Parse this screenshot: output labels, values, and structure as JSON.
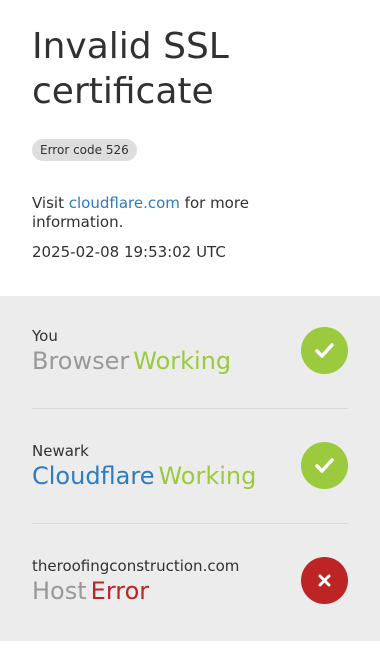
{
  "header": {
    "title": "Invalid SSL certificate",
    "error_code": "Error code 526",
    "visit_prefix": "Visit",
    "visit_link": "cloudflare.com",
    "visit_suffix": "for more information.",
    "timestamp": "2025-02-08 19:53:02 UTC"
  },
  "status": {
    "rows": [
      {
        "location": "You",
        "name": "Browser",
        "status": "Working",
        "state": "ok",
        "icon": "checkmark-icon"
      },
      {
        "location": "Newark",
        "name": "Cloudflare",
        "status": "Working",
        "state": "ok",
        "icon": "checkmark-icon"
      },
      {
        "location": "theroofingconstruction.com",
        "name": "Host",
        "status": "Error",
        "state": "error",
        "icon": "x-icon"
      }
    ]
  },
  "colors": {
    "ok": "#9bca3e",
    "error": "#bd2426",
    "link": "#2f7bbf",
    "panel_bg": "#ececec"
  }
}
